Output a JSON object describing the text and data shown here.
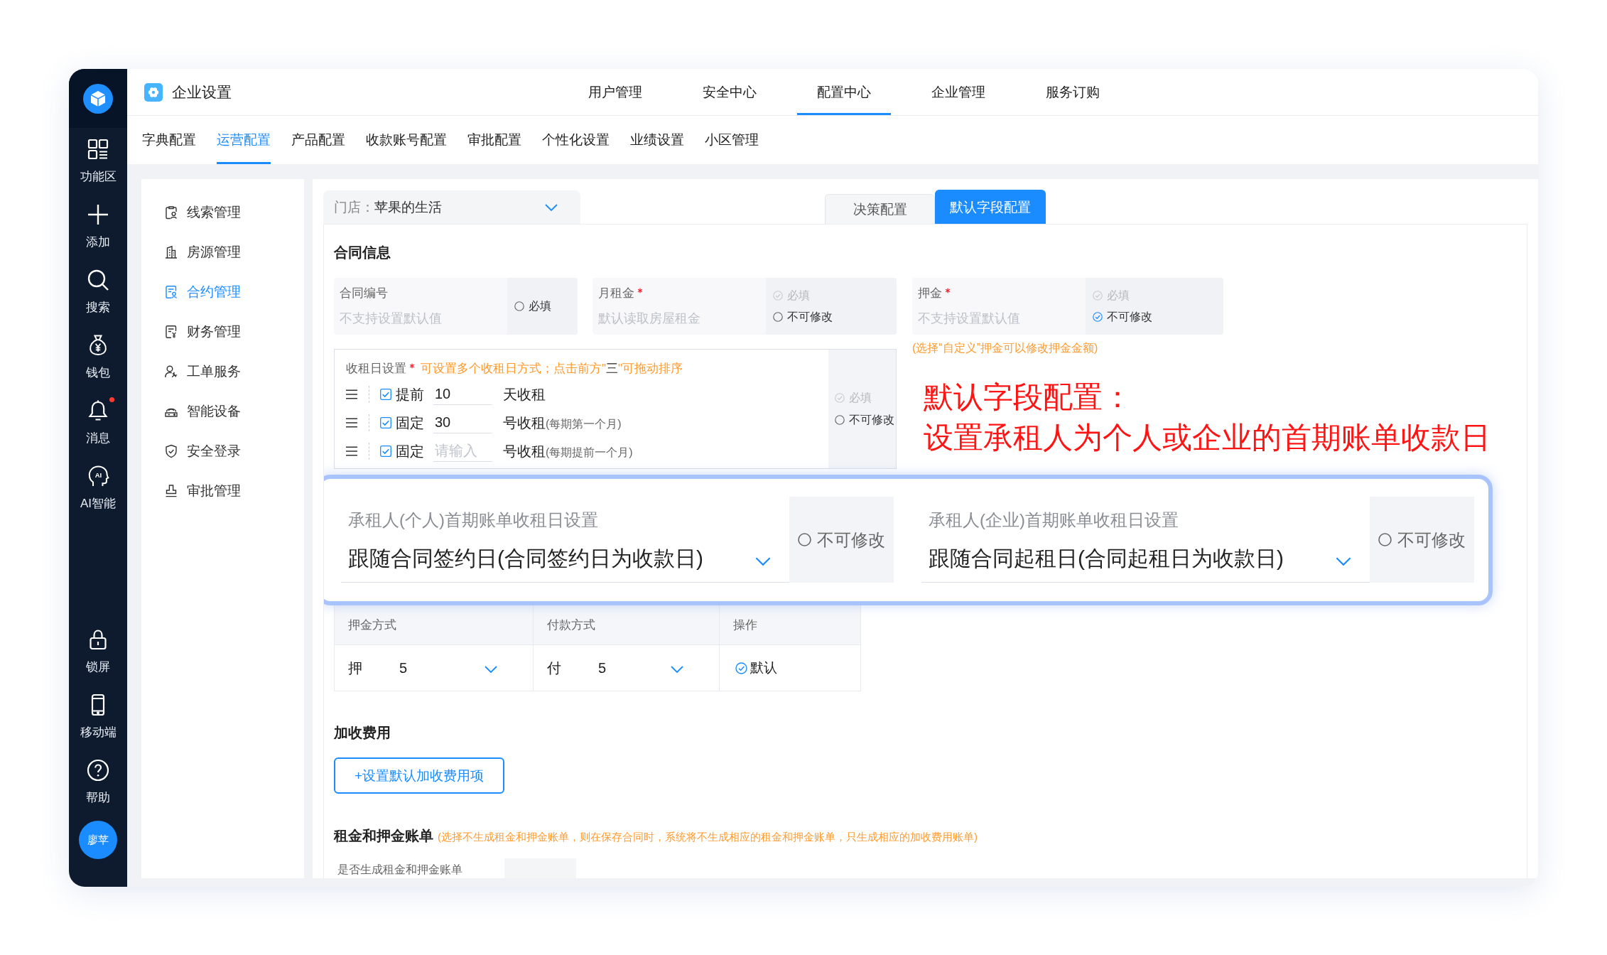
{
  "sidebar": {
    "items": [
      {
        "label": "功能区",
        "alert": false
      },
      {
        "label": "添加",
        "alert": false
      },
      {
        "label": "搜索",
        "alert": false
      },
      {
        "label": "钱包",
        "alert": false
      },
      {
        "label": "消息",
        "alert": true
      },
      {
        "label": "AI智能",
        "alert": false,
        "icon_text": "AI"
      }
    ],
    "bottom_items": [
      {
        "label": "锁屏"
      },
      {
        "label": "移动端"
      },
      {
        "label": "帮助"
      }
    ],
    "avatar": "廖苹"
  },
  "header": {
    "title": "企业设置",
    "nav": [
      {
        "label": "用户管理",
        "selected": false
      },
      {
        "label": "安全中心",
        "selected": false
      },
      {
        "label": "配置中心",
        "selected": true
      },
      {
        "label": "企业管理",
        "selected": false
      },
      {
        "label": "服务订购",
        "selected": false
      }
    ]
  },
  "sub_tabs": [
    {
      "label": "字典配置",
      "selected": false
    },
    {
      "label": "运营配置",
      "selected": true
    },
    {
      "label": "产品配置",
      "selected": false
    },
    {
      "label": "收款账号配置",
      "selected": false
    },
    {
      "label": "审批配置",
      "selected": false
    },
    {
      "label": "个性化设置",
      "selected": false
    },
    {
      "label": "业绩设置",
      "selected": false
    },
    {
      "label": "小区管理",
      "selected": false
    }
  ],
  "side_menu": [
    {
      "label": "线索管理",
      "selected": false
    },
    {
      "label": "房源管理",
      "selected": false
    },
    {
      "label": "合约管理",
      "selected": true
    },
    {
      "label": "财务管理",
      "selected": false
    },
    {
      "label": "工单服务",
      "selected": false
    },
    {
      "label": "智能设备",
      "selected": false
    },
    {
      "label": "安全登录",
      "selected": false
    },
    {
      "label": "审批管理",
      "selected": false
    }
  ],
  "store_select": {
    "label": "门店：",
    "value": "苹果的生活"
  },
  "mode_tabs": [
    {
      "label": "决策配置",
      "selected": false
    },
    {
      "label": "默认字段配置",
      "selected": true
    }
  ],
  "contract_info": {
    "title": "合同信息",
    "fields": [
      {
        "label": "合同编号",
        "required": false,
        "hint": "不支持设置默认值",
        "options": [
          {
            "label": "必填",
            "checked": false,
            "disabled": false
          }
        ]
      },
      {
        "label": "月租金",
        "required": true,
        "hint": "默认读取房屋租金",
        "options": [
          {
            "label": "必填",
            "checked": true,
            "disabled": true
          },
          {
            "label": "不可修改",
            "checked": false,
            "disabled": false
          }
        ]
      },
      {
        "label": "押金",
        "required": true,
        "hint": "不支持设置默认值",
        "options": [
          {
            "label": "必填",
            "checked": true,
            "disabled": true
          },
          {
            "label": "不可修改",
            "checked": true,
            "disabled": false
          }
        ],
        "note": "(选择“自定义”押金可以修改押金金额)"
      }
    ],
    "rent_day": {
      "label": "收租日设置",
      "required": true,
      "hint_parts": [
        {
          "text": "可设置多个收租日方式；点击前方\"",
          "kind": "note"
        },
        {
          "text": "三",
          "kind": "plain"
        },
        {
          "text": "\"可拖动排序",
          "kind": "note"
        }
      ],
      "rows": [
        {
          "checked": true,
          "mode": "提前",
          "value": "10",
          "unit": "天收租"
        },
        {
          "checked": true,
          "mode": "固定",
          "value": "30",
          "unit": "号收租",
          "note": "(每期第一个月)"
        },
        {
          "checked": true,
          "mode": "固定",
          "placeholder": "请输入",
          "unit": "号收租",
          "note": "(每期提前一个月)"
        }
      ],
      "options": [
        {
          "label": "必填",
          "checked": true,
          "disabled": true
        },
        {
          "label": "不可修改",
          "checked": false,
          "disabled": false
        }
      ]
    }
  },
  "annotation": [
    "默认字段配置：",
    "设置承租人为个人或企业的首期账单收款日"
  ],
  "first_bill_settings": [
    {
      "label": "承租人(个人)首期账单收租日设置",
      "value": "跟随合同签约日(合同签约日为收款日)",
      "lock": {
        "label": "不可修改",
        "checked": false
      }
    },
    {
      "label": "承租人(企业)首期账单收租日设置",
      "value": "跟随合同起租日(合同起租日为收款日)",
      "lock": {
        "label": "不可修改",
        "checked": false
      }
    }
  ],
  "deposit_table": {
    "columns": [
      "押金方式",
      "付款方式",
      "操作"
    ],
    "rows": [
      {
        "deposit": {
          "prefix": "押",
          "value": "5"
        },
        "payment": {
          "prefix": "付",
          "value": "5"
        },
        "action": {
          "label": "默认",
          "checked": true
        }
      }
    ]
  },
  "extra_fees": {
    "title": "加收费用",
    "button": "+设置默认加收费用项"
  },
  "bills": {
    "title": "租金和押金账单",
    "note": "(选择不生成租金和押金账单，则在保存合同时，系统将不生成相应的租金和押金账单，只生成相应的加收费用账单)",
    "field_label": "是否生成租金和押金账单"
  }
}
